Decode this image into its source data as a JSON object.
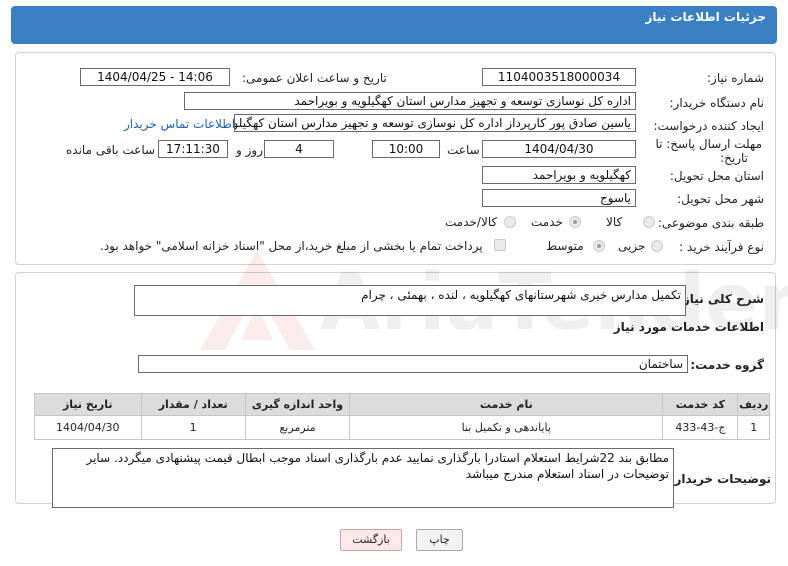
{
  "header": {
    "title": "جزئیات اطلاعات نیاز"
  },
  "form": {
    "need_number_label": "شماره نیاز:",
    "need_number": "1104003518000034",
    "announce_label": "تاریخ و ساعت اعلان عمومی:",
    "announce_value": "1404/04/25 - 14:06",
    "buyer_org_label": "نام دستگاه خریدار:",
    "buyer_org": "اداره کل نوسازی  توسعه و تجهیز مدارس استان کهگیلویه و بویراحمد",
    "creator_label": "ایجاد کننده درخواست:",
    "creator": "یاسین صادق پور کارپرداز اداره کل نوسازی  توسعه و تجهیز مدارس استان کهگیلویه",
    "contact_link": "اطلاعات تماس خریدار",
    "deadline_label_line1": "مهلت ارسال پاسخ: تا",
    "deadline_label_line2": "تاریخ:",
    "deadline_date": "1404/04/30",
    "time_label": "ساعت",
    "deadline_time": "10:00",
    "days_value": "4",
    "days_label": "روز و",
    "remaining_time": "17:11:30",
    "remaining_label": "ساعت باقی مانده",
    "province_label": "استان محل تحویل:",
    "province": "کهگیلویه و بویراحمد",
    "city_label": "شهر محل تحویل:",
    "city": "یاسوج",
    "category_label": "طبقه بندی موضوعی:",
    "category_options": [
      "کالا",
      "خدمت",
      "کالا/خدمت"
    ],
    "category_selected": "خدمت",
    "process_label": "نوع فرآیند خرید :",
    "process_options": [
      "جزیی",
      "متوسط"
    ],
    "process_selected": "متوسط",
    "payment_note": "پرداخت تمام یا بخشی از مبلغ خرید،از محل \"اسناد خزانه اسلامی\" خواهد بود."
  },
  "description": {
    "label": "شرح کلی نیاز:",
    "text": "تکمیل مدارس خیری شهرستانهای کهگیلویه ، لنده ، بهمئی ، چرام"
  },
  "services": {
    "section_title": "اطلاعات خدمات مورد نیاز",
    "group_label": "گروه خدمت:",
    "group_value": "ساختمان",
    "columns": [
      "ردیف",
      "کد خدمت",
      "نام خدمت",
      "واحد اندازه گیری",
      "تعداد / مقدار",
      "تاریخ نیاز"
    ],
    "rows": [
      [
        "1",
        "ج-43-433",
        "پایاندهی و تکمیل بنا",
        "مترمربع",
        "1",
        "1404/04/30"
      ]
    ]
  },
  "buyer_notes": {
    "label": "توضیحات خریدار:",
    "text": "مطابق بند 22شرایط استعلام استادرا بارگذاری نمایید عدم بارگذاری اسناد موجب ابطال قیمت پیشنهادی میگردد. سایر توضیحات در اسناد استعلام مندرج میباشد"
  },
  "buttons": {
    "print": "چاپ",
    "back": "بازگشت"
  },
  "watermark": {
    "text": "AriaTender.neT"
  }
}
